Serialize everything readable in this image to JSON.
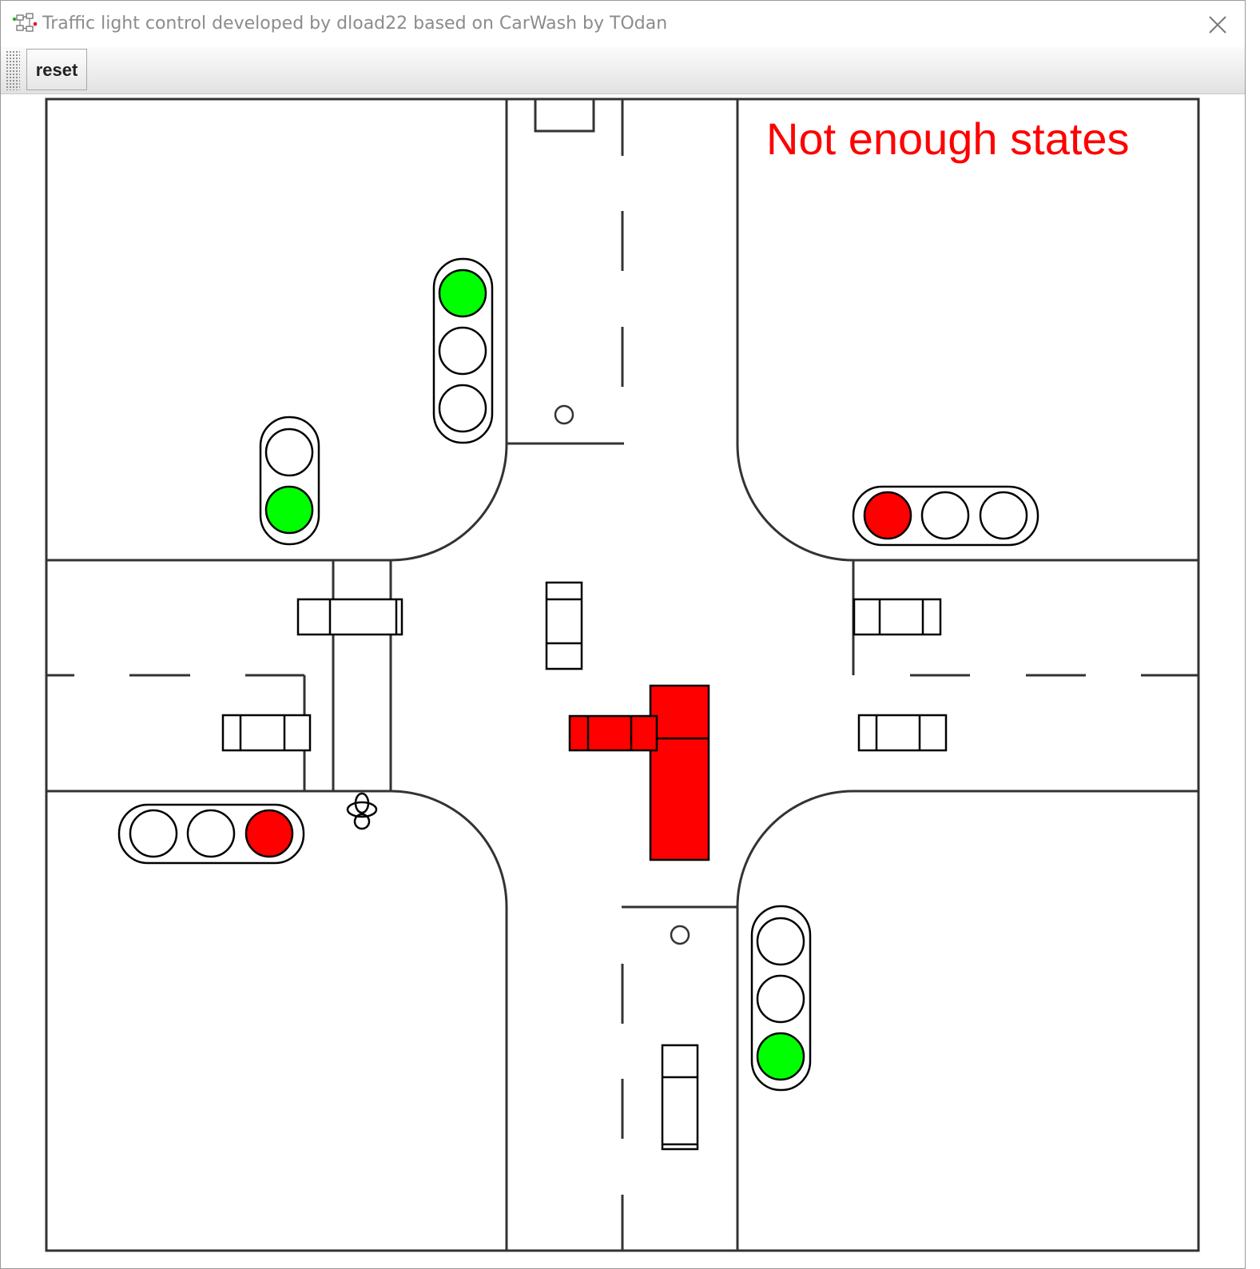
{
  "window": {
    "title": "Traffic light control developed by dload22 based on CarWash by TOdan",
    "app_icon": "state-machine-icon",
    "close_icon": "close-icon"
  },
  "toolbar": {
    "reset_label": "reset"
  },
  "status": {
    "message": "Not enough states",
    "color": "#ff0000"
  },
  "colors": {
    "lamp_green": "#00ff00",
    "lamp_red": "#ff0000",
    "lamp_off": "#ffffff",
    "car_active": "#ff0000",
    "outline": "#333333"
  },
  "traffic_lights": [
    {
      "id": "north",
      "orientation": "vertical",
      "lamps": [
        "green",
        "off",
        "off"
      ]
    },
    {
      "id": "north-pedestrian",
      "orientation": "vertical",
      "lamps": [
        "off",
        "green"
      ]
    },
    {
      "id": "east",
      "orientation": "horizontal",
      "lamps": [
        "red",
        "off",
        "off"
      ]
    },
    {
      "id": "west",
      "orientation": "horizontal",
      "lamps": [
        "off",
        "off",
        "red"
      ]
    },
    {
      "id": "south",
      "orientation": "vertical",
      "lamps": [
        "off",
        "off",
        "green"
      ]
    }
  ]
}
